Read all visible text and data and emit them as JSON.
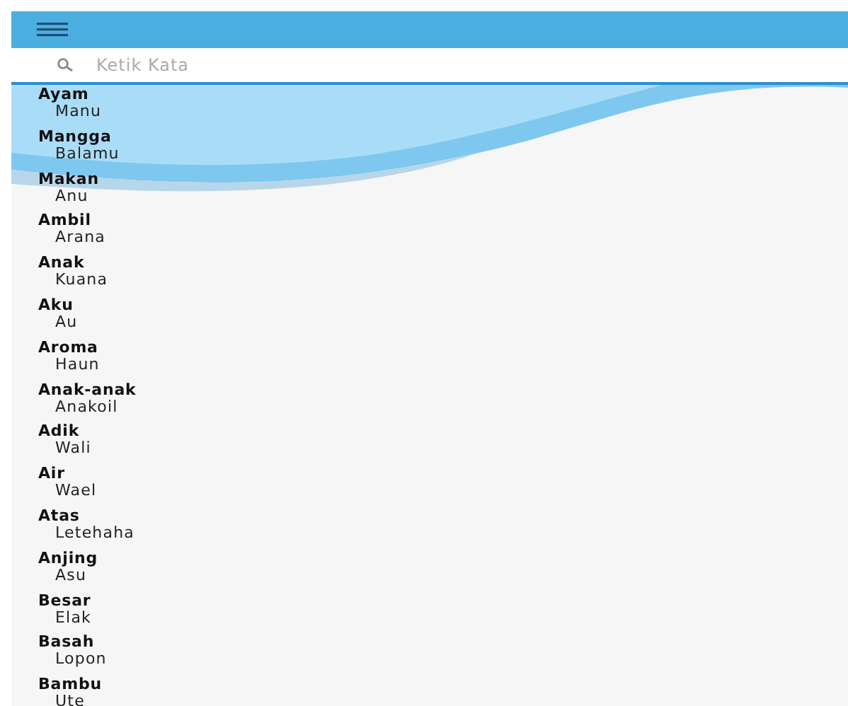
{
  "search": {
    "placeholder": "Ketik Kata"
  },
  "entries": [
    {
      "word": "Ayam",
      "translation": "Manu"
    },
    {
      "word": "Mangga",
      "translation": "Balamu"
    },
    {
      "word": "Makan",
      "translation": "Anu"
    },
    {
      "word": "Ambil",
      "translation": "Arana"
    },
    {
      "word": "Anak",
      "translation": "Kuana"
    },
    {
      "word": "Aku",
      "translation": "Au"
    },
    {
      "word": "Aroma",
      "translation": "Haun"
    },
    {
      "word": "Anak-anak",
      "translation": "Anakoil"
    },
    {
      "word": "Adik",
      "translation": "Wali"
    },
    {
      "word": "Air",
      "translation": "Wael"
    },
    {
      "word": "Atas",
      "translation": "Letehaha"
    },
    {
      "word": "Anjing",
      "translation": "Asu"
    },
    {
      "word": "Besar",
      "translation": "Elak"
    },
    {
      "word": "Basah",
      "translation": "Lopon"
    },
    {
      "word": "Bambu",
      "translation": "Ute"
    }
  ]
}
